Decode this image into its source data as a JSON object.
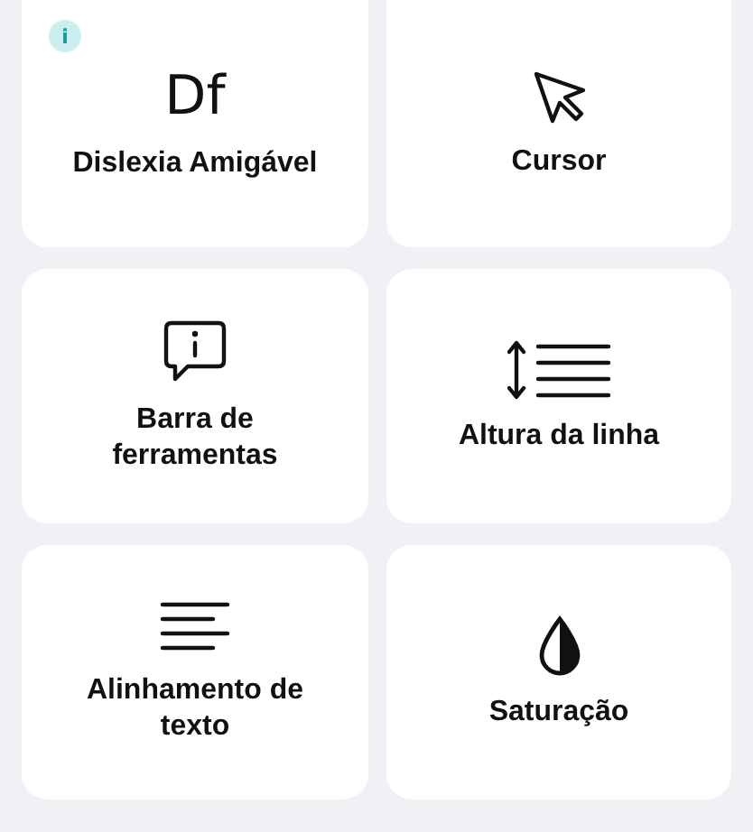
{
  "info_badge": "i",
  "cards": [
    {
      "label": "Dislexia Amigável",
      "kind": "glyph",
      "glyph": "Df"
    },
    {
      "label": "Cursor",
      "kind": "cursor"
    },
    {
      "label": "Barra de ferramentas",
      "kind": "tooltip"
    },
    {
      "label": "Altura da linha",
      "kind": "lineheight"
    },
    {
      "label": "Alinhamento de texto",
      "kind": "align"
    },
    {
      "label": "Saturação",
      "kind": "drop"
    }
  ]
}
